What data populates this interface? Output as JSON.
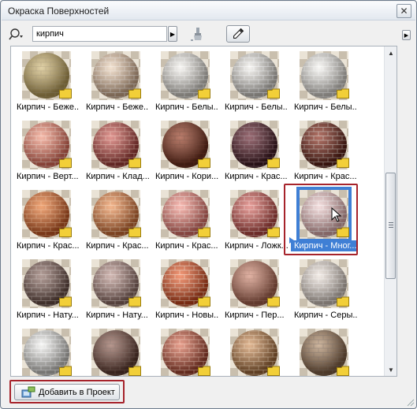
{
  "window": {
    "title": "Окраска Поверхностей",
    "close_label": "✕"
  },
  "toolbar": {
    "search_value": "кирпич",
    "search_icon": "search-icon",
    "brush_icon": "brush-icon",
    "eyedropper_icon": "eyedropper-icon"
  },
  "materials": [
    {
      "label": "Кирпич - Беже...",
      "c1": "#d8c38a",
      "c2": "#a38a4a",
      "mortar": "#b8a472"
    },
    {
      "label": "Кирпич - Беже...",
      "c1": "#efd9c2",
      "c2": "#b9977a",
      "mortar": "#f4e7da"
    },
    {
      "label": "Кирпич - Белы...",
      "c1": "#f4f2ee",
      "c2": "#b9b5ae",
      "mortar": "#fdfcf9"
    },
    {
      "label": "Кирпич - Белы...",
      "c1": "#f3f1ed",
      "c2": "#b2aea8",
      "mortar": "#ffffff"
    },
    {
      "label": "Кирпич - Белы...",
      "c1": "#f6f5f2",
      "c2": "#bdb9b3",
      "mortar": "#fdfdfb"
    },
    {
      "label": "Кирпич - Верт...",
      "c1": "#f3a58f",
      "c2": "#c85c4c",
      "mortar": "#f8c7b8"
    },
    {
      "label": "Кирпич - Клад...",
      "c1": "#d8756e",
      "c2": "#8e3430",
      "mortar": "#e7a69a"
    },
    {
      "label": "Кирпич - Кори...",
      "c1": "#a5523a",
      "c2": "#5a2618",
      "mortar": "#7d3d2a"
    },
    {
      "label": "Кирпич - Крас...",
      "c1": "#7a3b46",
      "c2": "#35161d",
      "mortar": "#8c6770"
    },
    {
      "label": "Кирпич - Крас...",
      "c1": "#9a4434",
      "c2": "#4d1b13",
      "mortar": "#c0a49a"
    },
    {
      "label": "Кирпич - Крас...",
      "c1": "#ec8a4c",
      "c2": "#b14d1f",
      "mortar": "#f2a877"
    },
    {
      "label": "Кирпич - Крас...",
      "c1": "#f0a06a",
      "c2": "#b65e2c",
      "mortar": "#f5c39c"
    },
    {
      "label": "Кирпич - Крас...",
      "c1": "#f6a69c",
      "c2": "#c6625a",
      "mortar": "#fbd0c8"
    },
    {
      "label": "Кирпич - Ложк...",
      "c1": "#e0807a",
      "c2": "#9f3c37",
      "mortar": "#f0bab4"
    },
    {
      "label": "Кирпич - Мног...",
      "c1": "#f1d6d6",
      "c2": "#c69696",
      "mortar": "#fbefef"
    },
    {
      "label": "Кирпич - Нату...",
      "c1": "#9b7e76",
      "c2": "#5a423b",
      "mortar": "#b8a59f"
    },
    {
      "label": "Кирпич - Нату...",
      "c1": "#c5a39c",
      "c2": "#7a5c55",
      "mortar": "#d8c2bd"
    },
    {
      "label": "Кирпич - Новы...",
      "c1": "#f0784c",
      "c2": "#b03b18",
      "mortar": "#f8c1a6"
    },
    {
      "label": "Кирпич - Пер...",
      "c1": "#d89a86",
      "c2": "#8f5240",
      "mortar": "#b87e6b"
    },
    {
      "label": "Кирпич - Серы...",
      "c1": "#efe6df",
      "c2": "#b7aca4",
      "mortar": "#f8f3ef"
    },
    {
      "label": "",
      "c1": "#f2f2f0",
      "c2": "#aeaca8",
      "mortar": "#ffffff"
    },
    {
      "label": "",
      "c1": "#a0766a",
      "c2": "#4e2f26",
      "mortar": "#806258"
    },
    {
      "label": "",
      "c1": "#e08068",
      "c2": "#8e3a28",
      "mortar": "#f1b29e"
    },
    {
      "label": "",
      "c1": "#d8a070",
      "c2": "#8a5a30",
      "mortar": "#e9c59f"
    },
    {
      "label": "",
      "c1": "#c0a080",
      "c2": "#6e5038",
      "mortar": "#8a7260"
    }
  ],
  "selected_index": 14,
  "add_button": {
    "label": "Добавить в Проект"
  },
  "colors": {
    "selection_blue": "#3f7fd5",
    "highlight_red": "#a6232b",
    "folder_yellow": "#f2cf38"
  }
}
